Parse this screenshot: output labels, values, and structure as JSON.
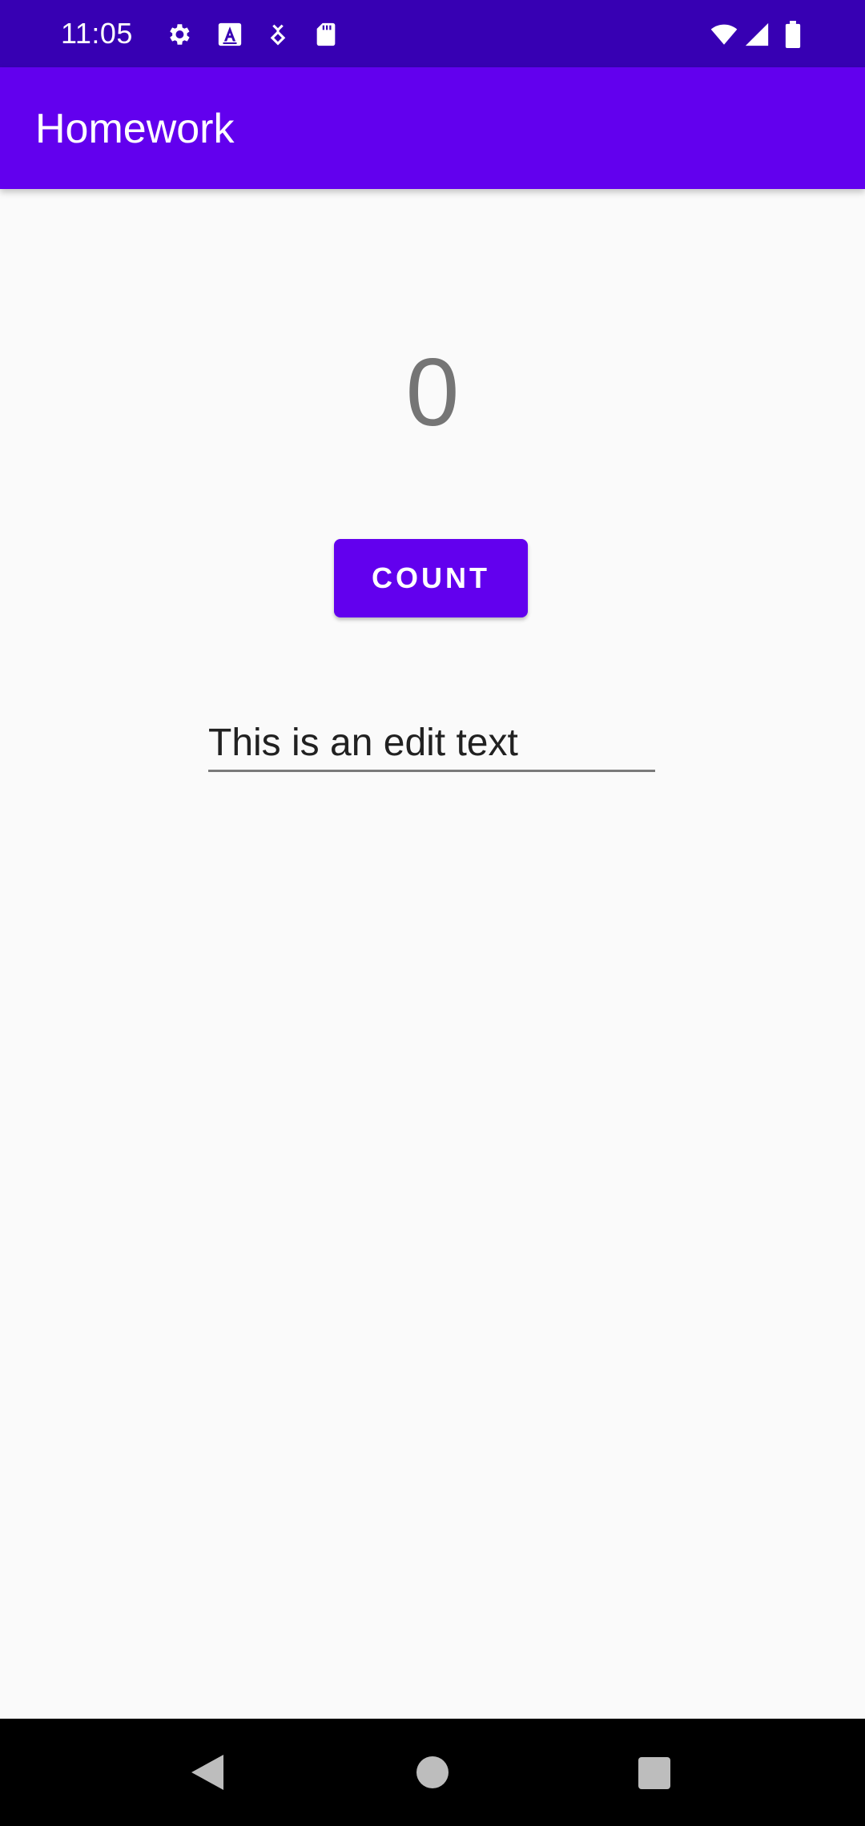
{
  "status_bar": {
    "time": "11:05",
    "icons": [
      "gear-icon",
      "text-a-icon",
      "transfer-icon",
      "sd-card-icon",
      "wifi-icon",
      "signal-icon",
      "battery-icon"
    ]
  },
  "app_bar": {
    "title": "Homework"
  },
  "main": {
    "counter_value": "0",
    "count_button_label": "COUNT",
    "edit_text_value": "This is an edit text"
  },
  "nav_bar": {
    "icons": [
      "back-icon",
      "home-icon",
      "recents-icon"
    ]
  },
  "colors": {
    "status_bar": "#3700b3",
    "primary": "#6200ee",
    "background": "#fafafa",
    "counter_text": "#757575"
  }
}
